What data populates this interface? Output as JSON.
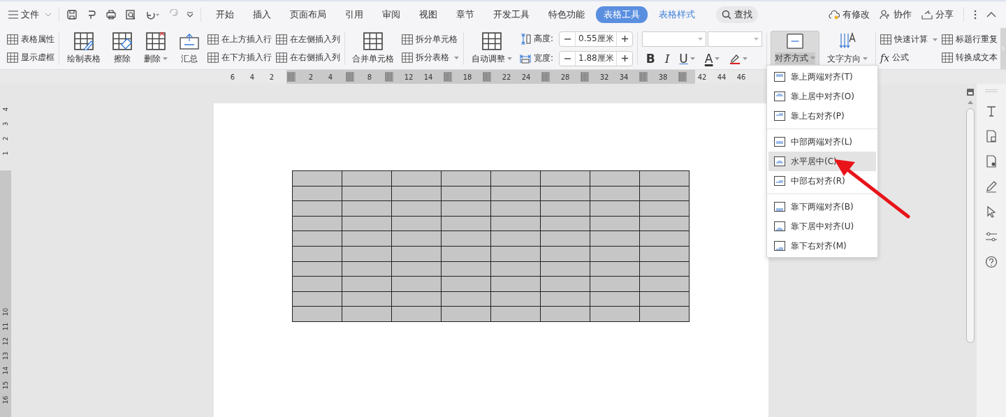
{
  "menu_bar": {
    "file_menu": "文件",
    "tabs": [
      {
        "label": "开始",
        "selected": false,
        "contextual": false
      },
      {
        "label": "插入",
        "selected": false,
        "contextual": false
      },
      {
        "label": "页面布局",
        "selected": false,
        "contextual": false
      },
      {
        "label": "引用",
        "selected": false,
        "contextual": false
      },
      {
        "label": "审阅",
        "selected": false,
        "contextual": false
      },
      {
        "label": "视图",
        "selected": false,
        "contextual": false
      },
      {
        "label": "章节",
        "selected": false,
        "contextual": false
      },
      {
        "label": "开发工具",
        "selected": false,
        "contextual": false
      },
      {
        "label": "特色功能",
        "selected": false,
        "contextual": false
      },
      {
        "label": "表格工具",
        "selected": true,
        "contextual": true
      },
      {
        "label": "表格样式",
        "selected": false,
        "contextual": true
      }
    ],
    "search": "查找",
    "actions": [
      "有修改",
      "协作",
      "分享"
    ]
  },
  "ribbon": {
    "groups": [
      {
        "columns": [
          {
            "kind": "stack",
            "items": [
              {
                "label": "表格属性",
                "dropdown": false
              },
              {
                "label": "显示虚框",
                "dropdown": false
              }
            ]
          }
        ]
      },
      {
        "columns": [
          {
            "kind": "large",
            "label": "绘制表格",
            "dropdown": false,
            "expanded": false
          },
          {
            "kind": "large",
            "label": "擦除",
            "dropdown": false,
            "expanded": false
          },
          {
            "kind": "large",
            "label": "删除",
            "dropdown": true,
            "expanded": false
          },
          {
            "kind": "large",
            "label": "汇总",
            "dropdown": false,
            "expanded": false
          },
          {
            "kind": "stack",
            "items": [
              {
                "label": "在上方插入行",
                "dropdown": false
              },
              {
                "label": "在下方插入行",
                "dropdown": false
              }
            ]
          },
          {
            "kind": "stack",
            "items": [
              {
                "label": "在左侧插入列",
                "dropdown": false
              },
              {
                "label": "在右侧插入列",
                "dropdown": false
              }
            ]
          }
        ]
      },
      {
        "columns": [
          {
            "kind": "large",
            "label": "合并单元格",
            "dropdown": false,
            "expanded": false
          },
          {
            "kind": "stack",
            "items": [
              {
                "label": "拆分单元格",
                "dropdown": false
              },
              {
                "label": "拆分表格",
                "dropdown": true
              }
            ]
          }
        ]
      },
      {
        "columns": [
          {
            "kind": "large",
            "label": "自动调整",
            "dropdown": true,
            "expanded": false
          },
          {
            "kind": "size_fields",
            "fields": [
              {
                "label": "高度:",
                "value": "0.55厘米"
              },
              {
                "label": "宽度:",
                "value": "1.88厘米"
              }
            ]
          }
        ]
      },
      {
        "columns": [
          {
            "kind": "font",
            "buttons": [
              {
                "kind": "bold",
                "glyph": "B",
                "dropdown": false
              },
              {
                "kind": "italic",
                "glyph": "I",
                "dropdown": false
              },
              {
                "kind": "underline",
                "glyph": "U",
                "dropdown": true
              },
              {
                "kind": "color",
                "glyph": "A",
                "dropdown": true
              },
              {
                "kind": "highlight",
                "dropdown": true
              }
            ]
          }
        ]
      },
      {
        "columns": [
          {
            "kind": "large",
            "label": "对齐方式",
            "dropdown": true,
            "expanded": true
          },
          {
            "kind": "large",
            "label": "文字方向",
            "dropdown": true,
            "expanded": false
          }
        ]
      },
      {
        "columns": [
          {
            "kind": "stack",
            "items": [
              {
                "label": "快速计算",
                "dropdown": true
              },
              {
                "label": "公式",
                "glyph": "fx",
                "dropdown": false
              }
            ]
          },
          {
            "kind": "stack",
            "items": [
              {
                "label": "标题行重复",
                "dropdown": false
              },
              {
                "label": "转换成文本",
                "dropdown": false
              }
            ]
          }
        ]
      }
    ]
  },
  "ruler": {
    "marks": [
      {
        "kind": "number",
        "label": "6"
      },
      {
        "kind": "number",
        "label": "4"
      },
      {
        "kind": "number",
        "label": "2"
      },
      {
        "kind": "marker"
      },
      {
        "kind": "number",
        "label": "2"
      },
      {
        "kind": "number",
        "label": "4"
      },
      {
        "kind": "marker"
      },
      {
        "kind": "number",
        "label": "8"
      },
      {
        "kind": "marker"
      },
      {
        "kind": "number",
        "label": "12"
      },
      {
        "kind": "number",
        "label": "14"
      },
      {
        "kind": "marker"
      },
      {
        "kind": "number",
        "label": "18"
      },
      {
        "kind": "marker"
      },
      {
        "kind": "number",
        "label": "22"
      },
      {
        "kind": "number",
        "label": "24"
      },
      {
        "kind": "marker"
      },
      {
        "kind": "number",
        "label": "28"
      },
      {
        "kind": "marker"
      },
      {
        "kind": "number",
        "label": "32"
      },
      {
        "kind": "number",
        "label": "34"
      },
      {
        "kind": "marker"
      },
      {
        "kind": "number",
        "label": "38"
      },
      {
        "kind": "marker"
      },
      {
        "kind": "number",
        "label": "42"
      },
      {
        "kind": "number",
        "label": "44"
      },
      {
        "kind": "number",
        "label": "46"
      }
    ]
  },
  "side_ruler": {
    "upper": [
      "4",
      "3",
      "2",
      "1"
    ],
    "lower": [
      "10",
      "11",
      "12",
      "13",
      "14",
      "15",
      "16"
    ]
  },
  "document": {
    "table": {
      "selected": true
    }
  },
  "alignment_menu": {
    "sections": [
      {
        "items": [
          {
            "label": "靠上两端对齐(T)",
            "selected": false
          },
          {
            "label": "靠上居中对齐(O)",
            "selected": false
          },
          {
            "label": "靠上右对齐(P)",
            "selected": false
          }
        ]
      },
      {
        "items": [
          {
            "label": "中部两端对齐(L)",
            "selected": false
          },
          {
            "label": "水平居中(C)",
            "selected": true
          },
          {
            "label": "中部右对齐(R)",
            "selected": false
          }
        ]
      },
      {
        "items": [
          {
            "label": "靠下两端对齐(B)",
            "selected": false
          },
          {
            "label": "靠下居中对齐(U)",
            "selected": false
          },
          {
            "label": "靠下右对齐(M)",
            "selected": false
          }
        ]
      }
    ]
  }
}
